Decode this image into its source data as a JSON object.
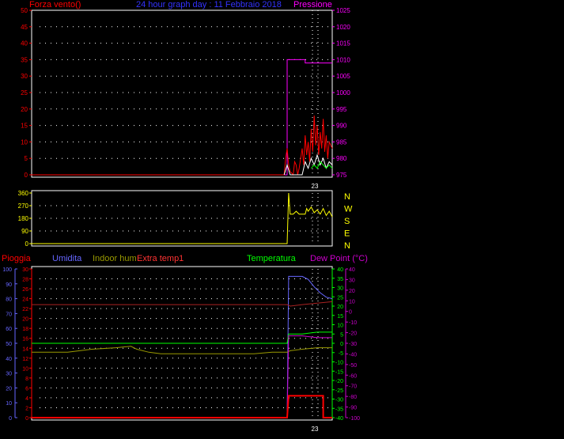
{
  "colors": {
    "wind": "#ff0000",
    "pressure": "#ff00ff",
    "title": "#3333ff",
    "direction": "#ffff00",
    "rain": "#ff0000",
    "humidity": "#6666ff",
    "indoor_hum": "#999900",
    "extra_temp": "#ff3333",
    "temperature": "#00ff00",
    "dew_point": "#cc00cc",
    "grid": "#ffffff",
    "frame": "#ffffff"
  },
  "chart_data": [
    {
      "type": "line",
      "title": "24 hour graph day : 11 Febbraio 2018",
      "left_axis_label": "Forza vento()",
      "right_axis_label": "Pressione",
      "x_tick_label": "23",
      "left_ylim": [
        0,
        50
      ],
      "left_ticks": [
        "0",
        "5",
        "10",
        "15",
        "20",
        "25",
        "30",
        "35",
        "40",
        "45",
        "50"
      ],
      "right_ylim": [
        975,
        1025
      ],
      "right_ticks": [
        "975",
        "980",
        "985",
        "990",
        "995",
        "1000",
        "1005",
        "1010",
        "1015",
        "1020",
        "1025"
      ],
      "series": [
        {
          "key": "pressure",
          "axis": "right",
          "points": [
            [
              0.0,
              975
            ],
            [
              0.85,
              975
            ],
            [
              0.85,
              1010
            ],
            [
              0.91,
              1010
            ],
            [
              0.91,
              1009
            ],
            [
              1.0,
              1009
            ]
          ]
        },
        {
          "key": "wind_red",
          "axis": "left",
          "points": [
            [
              0.0,
              0
            ],
            [
              0.84,
              0
            ],
            [
              0.845,
              5
            ],
            [
              0.85,
              8
            ],
            [
              0.855,
              3
            ],
            [
              0.86,
              1
            ],
            [
              0.87,
              0
            ],
            [
              0.875,
              4
            ],
            [
              0.88,
              3
            ],
            [
              0.885,
              0
            ],
            [
              0.89,
              2
            ],
            [
              0.895,
              5
            ],
            [
              0.9,
              8
            ],
            [
              0.905,
              3
            ],
            [
              0.91,
              12
            ],
            [
              0.915,
              6
            ],
            [
              0.92,
              10
            ],
            [
              0.925,
              4
            ],
            [
              0.93,
              14
            ],
            [
              0.935,
              7
            ],
            [
              0.94,
              18
            ],
            [
              0.945,
              9
            ],
            [
              0.95,
              15
            ],
            [
              0.955,
              6
            ],
            [
              0.96,
              13
            ],
            [
              0.965,
              8
            ],
            [
              0.97,
              17
            ],
            [
              0.975,
              7
            ],
            [
              0.98,
              12
            ],
            [
              0.985,
              5
            ],
            [
              0.99,
              10
            ],
            [
              1.0,
              8
            ]
          ]
        },
        {
          "key": "wind_white",
          "axis": "left",
          "points": [
            [
              0.84,
              0
            ],
            [
              0.85,
              3
            ],
            [
              0.86,
              0
            ],
            [
              0.9,
              0
            ],
            [
              0.91,
              4
            ],
            [
              0.92,
              2
            ],
            [
              0.93,
              5
            ],
            [
              0.94,
              3
            ],
            [
              0.95,
              6
            ],
            [
              0.96,
              3
            ],
            [
              0.97,
              5
            ],
            [
              0.98,
              2
            ],
            [
              0.99,
              4
            ],
            [
              1.0,
              3
            ]
          ]
        },
        {
          "key": "wind_green",
          "axis": "left",
          "points": [
            [
              0.93,
              2
            ],
            [
              0.94,
              3
            ],
            [
              0.95,
              2
            ],
            [
              0.96,
              4
            ],
            [
              0.97,
              3
            ],
            [
              0.98,
              2
            ],
            [
              0.99,
              3
            ],
            [
              1.0,
              2
            ]
          ]
        }
      ]
    },
    {
      "type": "line",
      "title": "",
      "x_tick_label": "",
      "left_ylim": [
        0,
        360
      ],
      "left_ticks": [
        "0",
        "90",
        "180",
        "270",
        "360"
      ],
      "right_labels": [
        "N",
        "W",
        "S",
        "E",
        "N"
      ],
      "series": [
        {
          "key": "direction",
          "axis": "left",
          "points": [
            [
              0.0,
              0
            ],
            [
              0.85,
              0
            ],
            [
              0.855,
              360
            ],
            [
              0.86,
              210
            ],
            [
              0.87,
              210
            ],
            [
              0.88,
              230
            ],
            [
              0.89,
              210
            ],
            [
              0.91,
              210
            ],
            [
              0.915,
              250
            ],
            [
              0.92,
              230
            ],
            [
              0.93,
              260
            ],
            [
              0.94,
              220
            ],
            [
              0.95,
              240
            ],
            [
              0.96,
              210
            ],
            [
              0.97,
              250
            ],
            [
              0.98,
              200
            ],
            [
              0.99,
              230
            ],
            [
              1.0,
              190
            ]
          ]
        }
      ]
    },
    {
      "type": "line",
      "title": "",
      "labels": {
        "rain": "Pioggia",
        "humidity": "Umidita",
        "indoor": "Indoor hum",
        "extra": "Extra temp1",
        "temperature": "Temperatura",
        "dew": "Dew Point (°C)"
      },
      "x_tick_label": "23",
      "hum_ticks": [
        "0",
        "10",
        "20",
        "30",
        "40",
        "50",
        "60",
        "70",
        "80",
        "90",
        "100"
      ],
      "hum_ylim": [
        0,
        100
      ],
      "rain_ticks": [
        "0",
        "2",
        "4",
        "6",
        "8",
        "10",
        "12",
        "14",
        "16",
        "18",
        "20",
        "22",
        "24",
        "26",
        "28",
        "30"
      ],
      "rain_ylim": [
        0,
        30
      ],
      "temp_ticks": [
        "-40",
        "-35",
        "-30",
        "-25",
        "-20",
        "-15",
        "-10",
        "-5",
        "0",
        "5",
        "10",
        "15",
        "20",
        "25",
        "30",
        "35",
        "40"
      ],
      "temp_ylim": [
        -40,
        40
      ],
      "dew_ticks": [
        "-100",
        "-90",
        "-80",
        "-70",
        "-60",
        "-50",
        "-40",
        "-30",
        "-20",
        "-10",
        "0",
        "10",
        "20",
        "30",
        "40"
      ],
      "dew_ylim": [
        -100,
        40
      ],
      "series": [
        {
          "key": "humidity",
          "axis": "hum",
          "points": [
            [
              0.85,
              0
            ],
            [
              0.855,
              95
            ],
            [
              0.9,
              95
            ],
            [
              0.92,
              93
            ],
            [
              0.94,
              88
            ],
            [
              0.96,
              84
            ],
            [
              0.98,
              81
            ],
            [
              1.0,
              80
            ]
          ]
        },
        {
          "key": "extra_temp",
          "axis": "hum",
          "points": [
            [
              0.0,
              76
            ],
            [
              0.85,
              76
            ],
            [
              0.86,
              75
            ],
            [
              0.9,
              76
            ],
            [
              0.95,
              77
            ],
            [
              1.0,
              78
            ]
          ]
        },
        {
          "key": "indoor_hum",
          "axis": "hum",
          "points": [
            [
              0.0,
              44
            ],
            [
              0.12,
              44
            ],
            [
              0.2,
              46
            ],
            [
              0.28,
              47
            ],
            [
              0.33,
              48
            ],
            [
              0.35,
              46
            ],
            [
              0.39,
              44
            ],
            [
              0.43,
              43
            ],
            [
              0.5,
              43
            ],
            [
              0.58,
              43
            ],
            [
              0.66,
              43
            ],
            [
              0.74,
              43
            ],
            [
              0.8,
              44
            ],
            [
              0.85,
              44
            ],
            [
              0.86,
              45
            ],
            [
              0.9,
              46
            ],
            [
              0.95,
              47
            ],
            [
              1.0,
              47
            ]
          ]
        },
        {
          "key": "temperature",
          "axis": "temp",
          "points": [
            [
              0.0,
              0
            ],
            [
              0.85,
              0
            ],
            [
              0.855,
              5
            ],
            [
              0.9,
              5
            ],
            [
              0.95,
              6
            ],
            [
              1.0,
              6
            ]
          ]
        },
        {
          "key": "dew_point",
          "axis": "temp",
          "points": [
            [
              0.85,
              -40
            ],
            [
              0.855,
              4
            ],
            [
              0.9,
              4
            ],
            [
              0.95,
              3
            ],
            [
              1.0,
              3
            ]
          ]
        },
        {
          "key": "rain",
          "axis": "rain",
          "points": [
            [
              0.0,
              0
            ],
            [
              0.85,
              0
            ],
            [
              0.855,
              4.4
            ],
            [
              0.97,
              4.4
            ],
            [
              0.97,
              0
            ],
            [
              1.0,
              0
            ]
          ]
        }
      ]
    }
  ]
}
